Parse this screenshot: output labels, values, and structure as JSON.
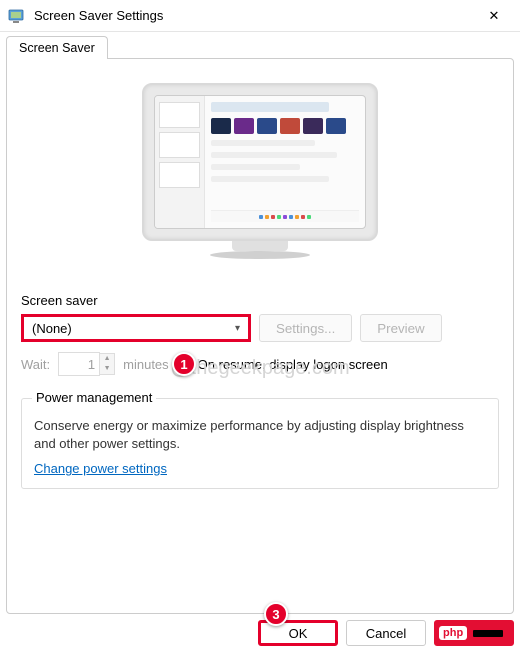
{
  "window": {
    "title": "Screen Saver Settings",
    "close_glyph": "✕"
  },
  "tabs": [
    {
      "label": "Screen Saver"
    }
  ],
  "screensaver": {
    "section_label": "Screen saver",
    "selected": "(None)",
    "settings_button": "Settings...",
    "preview_button": "Preview"
  },
  "wait": {
    "label": "Wait:",
    "value": "1",
    "unit": "minutes",
    "resume_label": "On resume, display logon screen"
  },
  "power": {
    "title": "Power management",
    "description": "Conserve energy or maximize performance by adjusting display brightness and other power settings.",
    "link": "Change power settings"
  },
  "footer": {
    "ok": "OK",
    "cancel": "Cancel",
    "apply_badge": "php"
  },
  "callouts": {
    "c1": "1",
    "c3": "3"
  },
  "watermark": "@thegeekpage.com"
}
